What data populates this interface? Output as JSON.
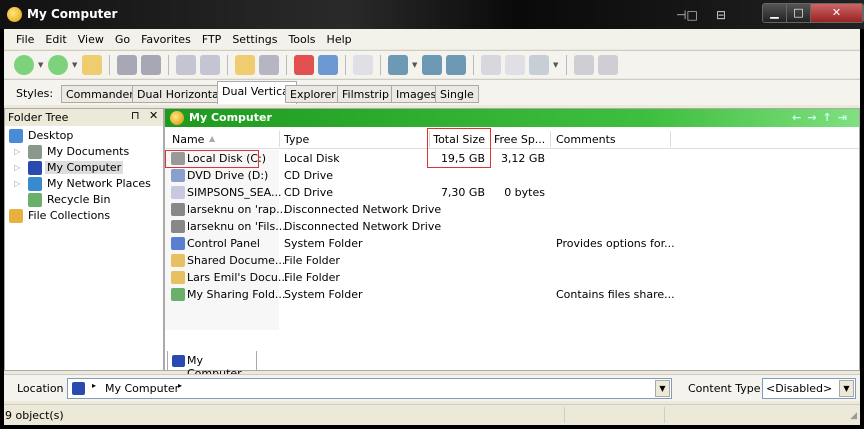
{
  "window": {
    "title": "My Computer",
    "buttons": [
      "minimize",
      "maximize",
      "close"
    ]
  },
  "menu": [
    "File",
    "Edit",
    "View",
    "Go",
    "Favorites",
    "FTP",
    "Settings",
    "Tools",
    "Help"
  ],
  "toolbar": {
    "icons": [
      "back-icon",
      "forward-icon",
      "up-folder-icon",
      "move-to-icon",
      "help-pointer-icon",
      "copy-icon",
      "paste-icon",
      "new-folder-icon",
      "rename-icon",
      "delete-icon",
      "undo-icon",
      "find-icon",
      "view-mode-icon",
      "dual-pane-icon",
      "properties-pane-icon",
      "checklist-icon",
      "thumbnail-icon",
      "edit-icon",
      "help-icon",
      "whats-this-icon"
    ]
  },
  "styles": {
    "label": "Styles:",
    "tabs": [
      "Commander",
      "Dual Horizontal",
      "Dual Vertical",
      "Explorer",
      "Filmstrip",
      "Images",
      "Single"
    ],
    "active": "Dual Vertical"
  },
  "folder_tree": {
    "title": "Folder Tree",
    "items": [
      {
        "label": "Desktop",
        "level": 0,
        "icon": "desktop-icon"
      },
      {
        "label": "My Documents",
        "level": 1,
        "icon": "my-documents-icon"
      },
      {
        "label": "My Computer",
        "level": 1,
        "icon": "my-computer-icon",
        "selected": true
      },
      {
        "label": "My Network Places",
        "level": 1,
        "icon": "network-icon"
      },
      {
        "label": "Recycle Bin",
        "level": 1,
        "icon": "recycle-bin-icon"
      },
      {
        "label": "File Collections",
        "level": 0,
        "icon": "file-collections-icon"
      }
    ]
  },
  "main": {
    "title": "My Computer",
    "columns": [
      "Name",
      "Type",
      "Total Size",
      "Free Sp...",
      "Comments"
    ],
    "rows": [
      {
        "name": "Local Disk (C:)",
        "type": "Local Disk",
        "total": "19,5 GB",
        "free": "3,12 GB",
        "comments": "",
        "icon": "hard-disk-icon",
        "color": "#999"
      },
      {
        "name": "DVD Drive (D:)",
        "type": "CD Drive",
        "total": "",
        "free": "",
        "comments": "",
        "icon": "dvd-drive-icon",
        "color": "#8a9fcc"
      },
      {
        "name": "SIMPSONS_SEA...",
        "type": "CD Drive",
        "total": "7,30 GB",
        "free": "0 bytes",
        "comments": "",
        "icon": "cd-icon",
        "color": "#c8c8e0"
      },
      {
        "name": "larseknu on 'rap...",
        "type": "Disconnected Network Drive",
        "total": "",
        "free": "",
        "comments": "",
        "icon": "network-drive-icon",
        "color": "#888"
      },
      {
        "name": "larseknu on 'Fils...",
        "type": "Disconnected Network Drive",
        "total": "",
        "free": "",
        "comments": "",
        "icon": "network-drive-icon",
        "color": "#888"
      },
      {
        "name": "Control Panel",
        "type": "System Folder",
        "total": "",
        "free": "",
        "comments": "Provides options for...",
        "icon": "control-panel-icon",
        "color": "#5a7fd0"
      },
      {
        "name": "Shared Docume...",
        "type": "File Folder",
        "total": "",
        "free": "",
        "comments": "",
        "icon": "folder-icon",
        "color": "#e8c060"
      },
      {
        "name": "Lars Emil's Docu...",
        "type": "File Folder",
        "total": "",
        "free": "",
        "comments": "",
        "icon": "folder-icon",
        "color": "#e8c060"
      },
      {
        "name": "My Sharing Fold...",
        "type": "System Folder",
        "total": "",
        "free": "",
        "comments": "Contains files share...",
        "icon": "sharing-folder-icon",
        "color": "#6ab06a"
      }
    ],
    "bottom_tab": "My Computer"
  },
  "location": {
    "label": "Location",
    "path": "My Computer",
    "content_type_label": "Content Type",
    "content_type_value": "<Disabled>"
  },
  "status": {
    "text": "9 object(s)"
  },
  "colors": {
    "accent_green": "#2eaa2e",
    "highlight": "#d33"
  }
}
